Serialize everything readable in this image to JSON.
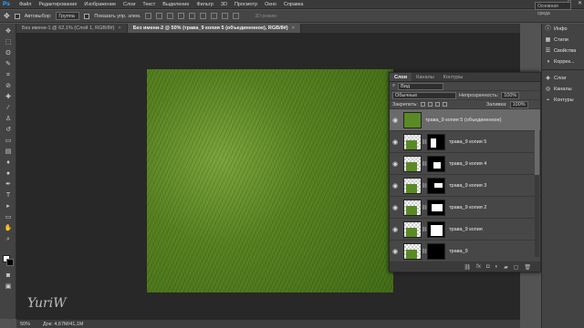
{
  "app": {
    "logo": "Ps"
  },
  "menu": [
    "Файл",
    "Редактирование",
    "Изображение",
    "Слои",
    "Текст",
    "Выделение",
    "Фильтр",
    "3D",
    "Просмотр",
    "Окно",
    "Справка"
  ],
  "window_controls": {
    "minimize": "—",
    "maximize": "□",
    "close": "✕"
  },
  "options": {
    "autoselect_label": "Автовыбор:",
    "autoselect_value": "Группа",
    "show_controls_label": "Показать упр. элем.",
    "mode3d_label": "3D-режим:",
    "workspace": "Основная среда"
  },
  "tabs": [
    {
      "label": "Без имени-1 @ 62,1% (Слой 1, RGB/8#)",
      "close": "×",
      "active": false
    },
    {
      "label": "Без имени-2 @ 50% (трава_9 копия 5 (объединенное), RGB/8#)",
      "close": "×",
      "active": true
    }
  ],
  "status": {
    "zoom": "50%",
    "doc": "Док: 4,67M/41,1M"
  },
  "watermark": "YuriW",
  "layers_panel": {
    "tabs": [
      "Слои",
      "Каналы",
      "Контуры"
    ],
    "kind_label": "Вид",
    "blend_mode": "Обычные",
    "opacity_label": "Непрозрачность:",
    "opacity_value": "100%",
    "lock_label": "Закрепить:",
    "fill_label": "Заливка:",
    "fill_value": "100%",
    "layers": [
      {
        "name": "трава_9 копия 5 (объединенное)",
        "selected": true,
        "has_mask": false
      },
      {
        "name": "трава_9 копия 5",
        "selected": false,
        "has_mask": true
      },
      {
        "name": "трава_9 копия 4",
        "selected": false,
        "has_mask": true
      },
      {
        "name": "трава_9 копия 3",
        "selected": false,
        "has_mask": true
      },
      {
        "name": "трава_9 копия 2",
        "selected": false,
        "has_mask": true
      },
      {
        "name": "трава_9 копия",
        "selected": false,
        "has_mask": true
      },
      {
        "name": "трава_9",
        "selected": false,
        "has_mask": true
      }
    ],
    "footer_icons": [
      "link-icon",
      "fx-icon",
      "mask-icon",
      "adjustment-icon",
      "group-icon",
      "new-layer-icon",
      "trash-icon"
    ]
  },
  "right_panels": {
    "group1": [
      {
        "icon": "info-icon",
        "label": "Инфо"
      },
      {
        "icon": "styles-icon",
        "label": "Стили"
      },
      {
        "icon": "properties-icon",
        "label": "Свойства"
      },
      {
        "icon": "adjustments-icon",
        "label": "Коррек..."
      }
    ],
    "group2": [
      {
        "icon": "layers-icon",
        "label": "Слои"
      },
      {
        "icon": "channels-icon",
        "label": "Каналы"
      },
      {
        "icon": "paths-icon",
        "label": "Контуры"
      }
    ]
  },
  "colors": {
    "accent": "#31a8ff",
    "canvas": "#282828",
    "grass": "#5a8a24"
  }
}
